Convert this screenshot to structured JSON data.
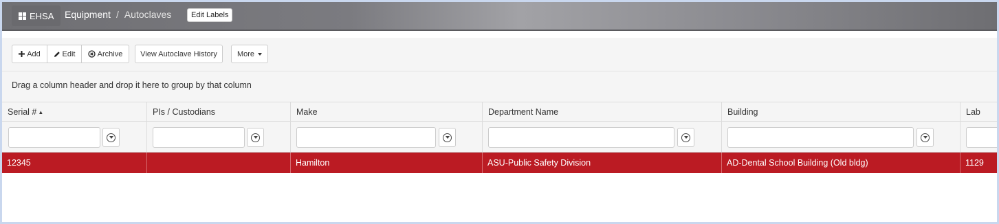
{
  "app": {
    "brand": "EHSA"
  },
  "breadcrumb": {
    "section": "Equipment",
    "separator": "/",
    "current": "Autoclaves"
  },
  "header": {
    "edit_labels": "Edit Labels"
  },
  "toolbar": {
    "add": "Add",
    "edit": "Edit",
    "archive": "Archive",
    "history": "View Autoclave History",
    "more": "More"
  },
  "group_panel": {
    "text": "Drag a column header and drop it here to group by that column"
  },
  "grid": {
    "columns": [
      "Serial #",
      "PIs / Custodians",
      "Make",
      "Department Name",
      "Building",
      "Lab"
    ],
    "sort_indicator": "▲",
    "rows": [
      {
        "serial": "12345",
        "pis": "",
        "make": "Hamilton",
        "department": "ASU-Public Safety Division",
        "building": "AD-Dental School Building (Old bldg)",
        "lab": "1129"
      }
    ]
  },
  "icons": {
    "add": "plus-icon",
    "edit": "pencil-icon",
    "archive": "circle-x-icon",
    "filter": "filter-icon",
    "brand": "grid-icon"
  },
  "colors": {
    "selected_row": "#bb1b23",
    "topbar": "#7b7b80"
  }
}
